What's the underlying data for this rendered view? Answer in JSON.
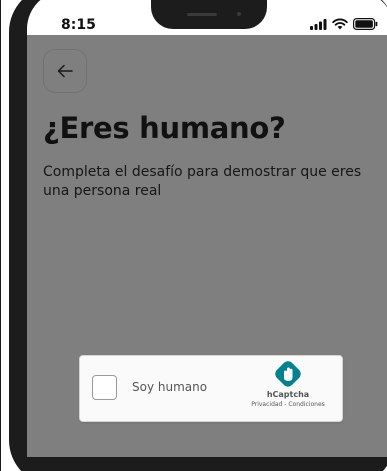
{
  "status_bar": {
    "time": "8:15"
  },
  "nav": {
    "back_icon": "arrow-left-icon"
  },
  "page": {
    "title": "¿Eres humano?",
    "subtitle": "Completa el desafío para demostrar que eres una persona real"
  },
  "captcha": {
    "checkbox_label": "Soy humano",
    "brand_name": "hCaptcha",
    "privacy_link": "Privacidad",
    "separator": " - ",
    "terms_link": "Condiciones"
  },
  "colors": {
    "overlay": "#000000",
    "title": "#222222",
    "hcaptcha_logo": "#00838f"
  }
}
